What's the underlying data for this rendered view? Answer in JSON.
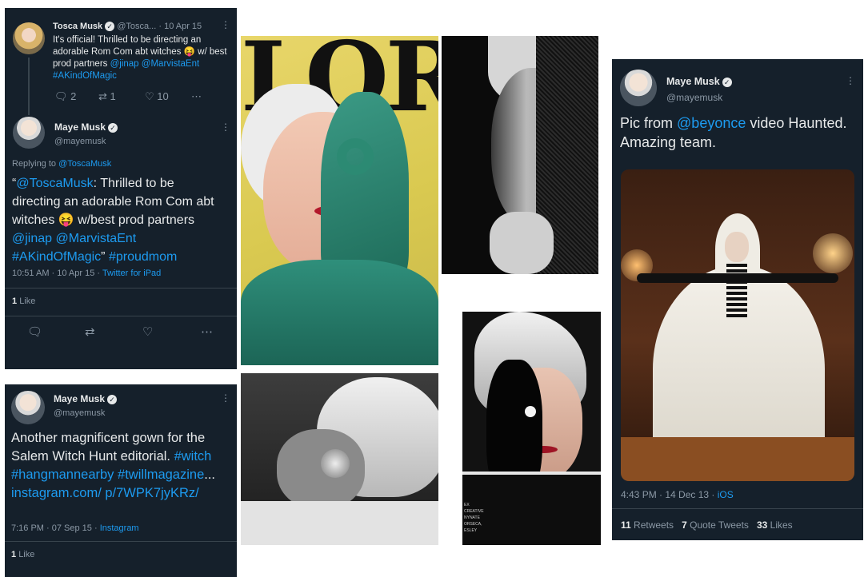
{
  "tweet1": {
    "name": "Tosca Musk",
    "handle": "@Tosca...",
    "date": "· 10 Apr 15",
    "text": "It's official! Thrilled to be directing an adorable Rom Com abt witches 😝 w/ best prod partners",
    "mention1": "@jinap",
    "mention2": "@MarvistaEnt",
    "hashtag": "#AKindOfMagic",
    "replies": "2",
    "retweets": "1",
    "likes": "10"
  },
  "reply": {
    "name": "Maye Musk",
    "handle": "@mayemusk",
    "replying_label": "Replying to",
    "replying_to": "@ToscaMusk",
    "open_quote": "“",
    "mention_tosca": "@ToscaMusk",
    "body1": ": Thrilled to be directing an adorable Rom Com abt witches 😝 w/best prod partners",
    "mention_jinap": "@jinap",
    "mention_marvista": "@MarvistaEnt",
    "hashtag1": "#AKindOfMagic",
    "close_quote": "”",
    "hashtag2": "#proudmom",
    "time": "10:51 AM · 10 Apr 15 ·",
    "client": "Twitter for iPad",
    "likes_count": "1",
    "likes_label": "Like"
  },
  "tweet3": {
    "name": "Maye Musk",
    "handle": "@mayemusk",
    "text": "Another magnificent gown for the Salem Witch Hunt editorial.",
    "tag1": "#witch",
    "tag2": "#hangmannearby",
    "tag3": "#twillmagazine",
    "ellipsis": "...",
    "link": "instagram.com/ p/7WPK7jyKRz/",
    "time": "7:16 PM · 07 Sep 15 ·",
    "client": "Instagram",
    "likes_count": "1",
    "likes_label": "Like"
  },
  "tweet4": {
    "name": "Maye Musk",
    "handle": "@mayemusk",
    "text_prefix": "Pic from",
    "mention": "@beyonce",
    "text_suffix": "video Haunted. Amazing team.",
    "time": "4:43 PM · 14 Dec 13 ·",
    "client": "iOS",
    "retweets_count": "11",
    "retweets_label": "Retweets",
    "quotes_count": "7",
    "quotes_label": "Quote Tweets",
    "likes_count": "33",
    "likes_label": "Likes"
  },
  "magazine": {
    "masthead": "LOR",
    "credit": "EX CREATIVE NYNATE ORSECA, ESLEY"
  },
  "icons": [
    "reply-icon",
    "retweet-icon",
    "like-icon",
    "share-icon",
    "more-icon",
    "verified-icon"
  ],
  "colors": {
    "card_bg": "#15202b",
    "link": "#1d9bf0",
    "muted": "#8b98a5"
  }
}
